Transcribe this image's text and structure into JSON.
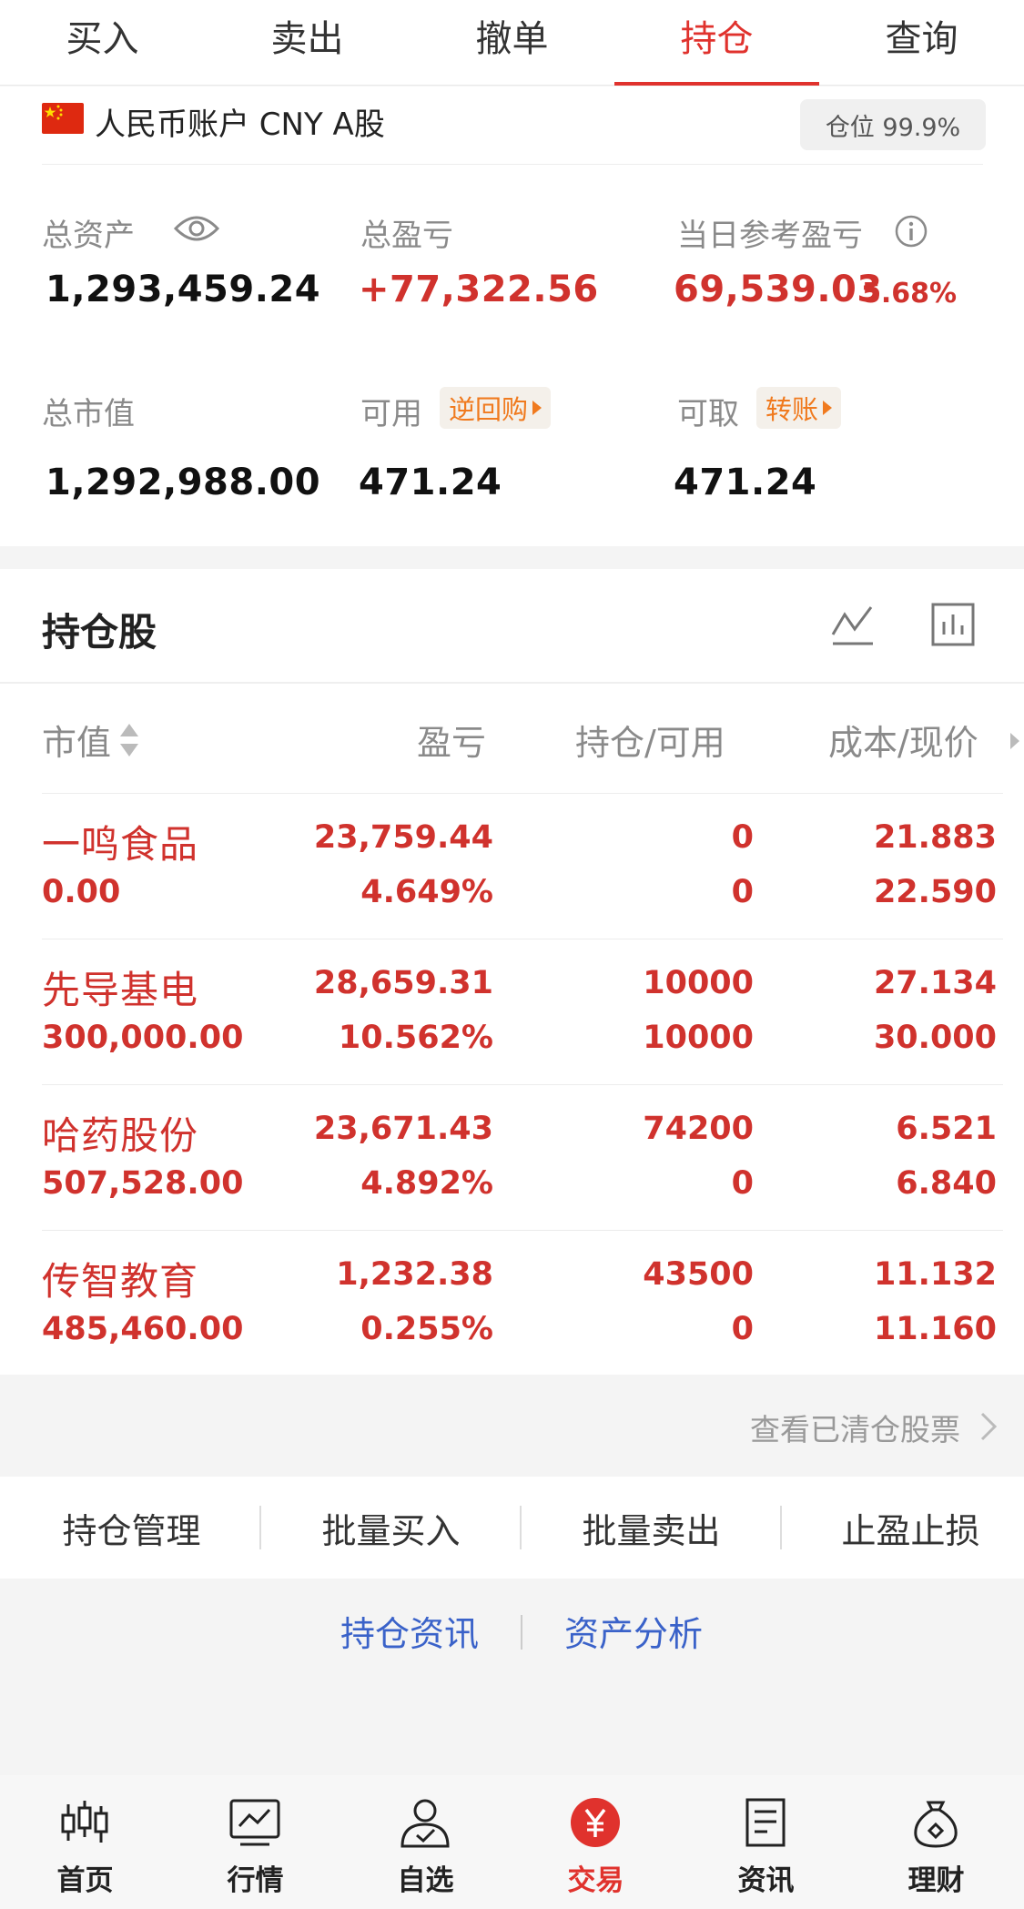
{
  "tabs": [
    {
      "label": "买入"
    },
    {
      "label": "卖出"
    },
    {
      "label": "撤单"
    },
    {
      "label": "持仓"
    },
    {
      "label": "查询"
    }
  ],
  "account": {
    "name": "人民币账户 CNY A股",
    "position_badge": "仓位 99.9%"
  },
  "summary": {
    "total_assets_label": "总资产",
    "total_assets": "1,293,459.24",
    "total_pnl_label": "总盈亏",
    "total_pnl": "+77,322.56",
    "daily_pnl_label": "当日参考盈亏",
    "daily_pnl": "69,539.03",
    "daily_pnl_pct": "5.68%",
    "market_value_label": "总市值",
    "market_value": "1,292,988.00",
    "available_label": "可用",
    "reverse_repo_tag": "逆回购",
    "available": "471.24",
    "withdrawable_label": "可取",
    "transfer_tag": "转账",
    "withdrawable": "471.24"
  },
  "positions": {
    "title": "持仓股",
    "headers": {
      "market_value": "市值",
      "pnl": "盈亏",
      "holding": "持仓/可用",
      "cost_price": "成本/现价"
    },
    "rows": [
      {
        "name": "一鸣食品",
        "market_value": "0.00",
        "pnl": "23,759.44",
        "pnl_pct": "4.649%",
        "holding": "0",
        "available": "0",
        "cost": "21.883",
        "price": "22.590"
      },
      {
        "name": "先导基电",
        "market_value": "300,000.00",
        "pnl": "28,659.31",
        "pnl_pct": "10.562%",
        "holding": "10000",
        "available": "10000",
        "cost": "27.134",
        "price": "30.000"
      },
      {
        "name": "哈药股份",
        "market_value": "507,528.00",
        "pnl": "23,671.43",
        "pnl_pct": "4.892%",
        "holding": "74200",
        "available": "0",
        "cost": "6.521",
        "price": "6.840"
      },
      {
        "name": "传智教育",
        "market_value": "485,460.00",
        "pnl": "1,232.38",
        "pnl_pct": "0.255%",
        "holding": "43500",
        "available": "0",
        "cost": "11.132",
        "price": "11.160"
      }
    ]
  },
  "cleared_link": "查看已清仓股票",
  "actions": [
    {
      "label": "持仓管理"
    },
    {
      "label": "批量买入"
    },
    {
      "label": "批量卖出"
    },
    {
      "label": "止盈止损"
    }
  ],
  "links": {
    "news": "持仓资讯",
    "analysis": "资产分析"
  },
  "nav": [
    {
      "label": "首页",
      "icon": "candlestick-icon"
    },
    {
      "label": "行情",
      "icon": "chart-icon"
    },
    {
      "label": "自选",
      "icon": "user-check-icon"
    },
    {
      "label": "交易",
      "icon": "yuan-icon"
    },
    {
      "label": "资讯",
      "icon": "document-icon"
    },
    {
      "label": "理财",
      "icon": "money-bag-icon"
    }
  ],
  "colors": {
    "accent": "#e0322d",
    "up": "#d0322d",
    "orange": "#f07a1e",
    "link": "#3a62c9"
  }
}
